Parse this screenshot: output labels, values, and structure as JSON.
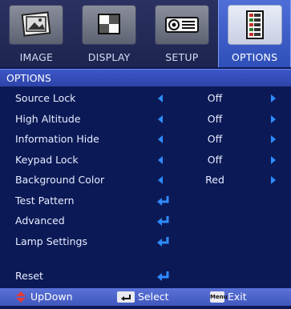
{
  "tabs": [
    {
      "label": "IMAGE",
      "icon": "image-icon",
      "active": false
    },
    {
      "label": "DISPLAY",
      "icon": "display-icon",
      "active": false
    },
    {
      "label": "SETUP",
      "icon": "projector-icon",
      "active": false
    },
    {
      "label": "OPTIONS",
      "icon": "options-list-icon",
      "active": true
    }
  ],
  "section_title": "OPTIONS",
  "menu": {
    "source_lock": {
      "label": "Source Lock",
      "value": "Off"
    },
    "high_altitude": {
      "label": "High Altitude",
      "value": "Off"
    },
    "information_hide": {
      "label": "Information Hide",
      "value": "Off"
    },
    "keypad_lock": {
      "label": "Keypad Lock",
      "value": "Off"
    },
    "background_color": {
      "label": "Background Color",
      "value": "Red"
    },
    "test_pattern": {
      "label": "Test Pattern"
    },
    "advanced": {
      "label": "Advanced"
    },
    "lamp_settings": {
      "label": "Lamp Settings"
    },
    "reset": {
      "label": "Reset"
    }
  },
  "footer": {
    "updown_label": "UpDown",
    "select_label": "Select",
    "menu_key_label": "Menu",
    "exit_label": "Exit"
  },
  "colors": {
    "background": "#0b1a56",
    "accent_blue": "#2f8bff",
    "header": "#3d56c9",
    "footer": "#4f66cc",
    "updown_key": "#e23a3a"
  }
}
